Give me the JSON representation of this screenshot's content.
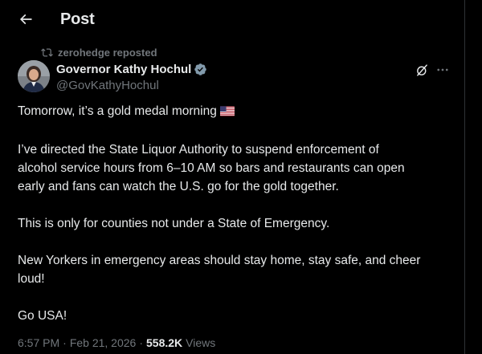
{
  "colors": {
    "background": "#000000",
    "text_primary": "#e7e9ea",
    "text_secondary": "#71767b",
    "verified_badge": "#829aab",
    "border": "#2f3336"
  },
  "header": {
    "title": "Post",
    "back_icon": "arrow-left-icon"
  },
  "repost": {
    "icon": "repost-icon",
    "text": "zerohedge reposted"
  },
  "author": {
    "name": "Governor Kathy Hochul",
    "handle": "@GovKathyHochul",
    "badge_icon": "verified-badge-icon"
  },
  "actions": {
    "grok_icon": "grok-icon",
    "more_icon": "more-options-icon"
  },
  "tweet": {
    "line1": "Tomorrow, it’s a gold medal morning",
    "flag_icon": "us-flag-icon",
    "para2_line1": "I’ve directed the State Liquor Authority to suspend enforcement of",
    "para2_line2": "alcohol service hours from 6–10 AM so bars and restaurants can open",
    "para2_line3": "early and fans can watch the U.S. go for the gold together.",
    "para3_line1": "This is only for counties not under a State of Emergency.",
    "para4_line1": "New Yorkers in emergency areas should stay home, stay safe, and cheer",
    "para4_line2": "loud!",
    "para5_line1": "Go USA!"
  },
  "meta": {
    "time": "6:57 PM",
    "separator1": "·",
    "date": "Feb 21, 2026",
    "separator2": "·",
    "views_count": "558.2K",
    "views_label": "Views"
  }
}
